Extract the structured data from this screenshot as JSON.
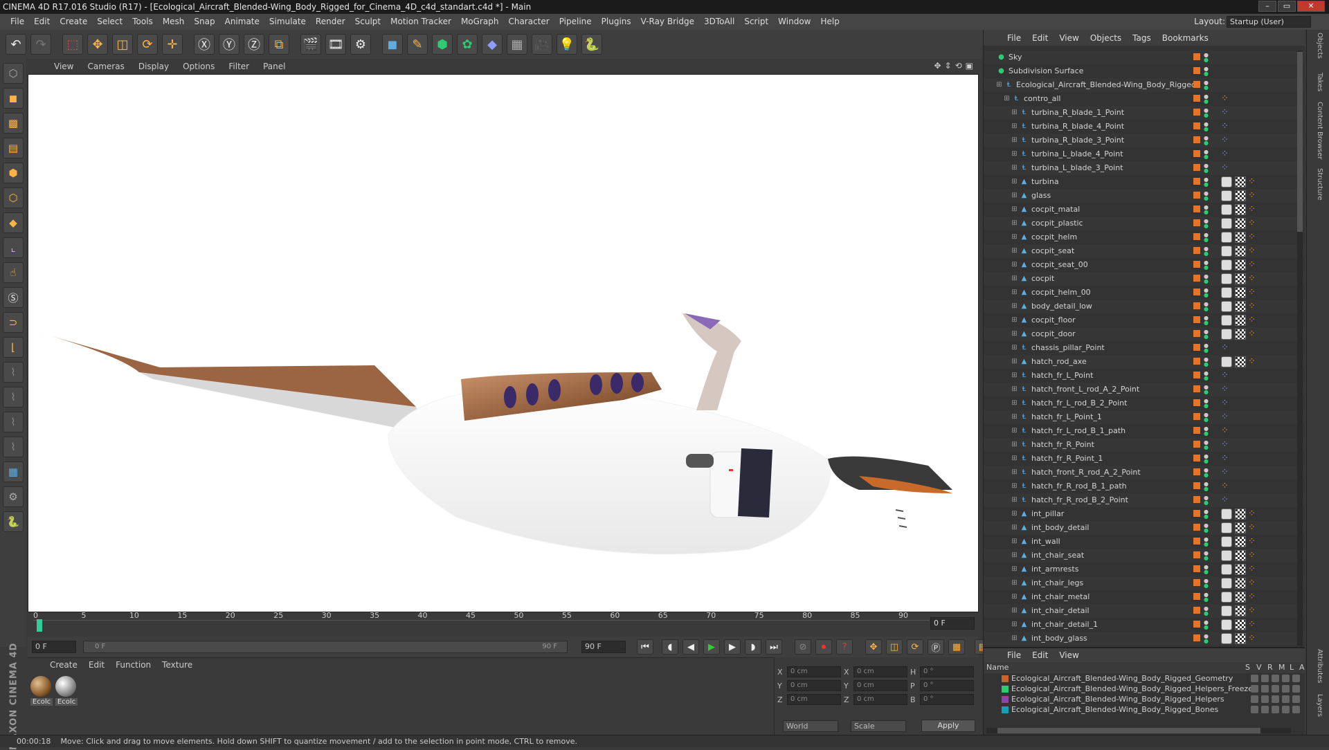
{
  "window": {
    "title": "CINEMA 4D R17.016 Studio (R17) - [Ecological_Aircraft_Blended-Wing_Body_Rigged_for_Cinema_4D_c4d_standart.c4d *] - Main",
    "buttons": [
      "–",
      "▭",
      "✕"
    ]
  },
  "menu": [
    "File",
    "Edit",
    "Create",
    "Select",
    "Tools",
    "Mesh",
    "Snap",
    "Animate",
    "Simulate",
    "Render",
    "Sculpt",
    "Motion Tracker",
    "MoGraph",
    "Character",
    "Pipeline",
    "Plugins",
    "V-Ray Bridge",
    "3DToAll",
    "Script",
    "Window",
    "Help"
  ],
  "layout": {
    "label": "Layout:",
    "value": "Startup (User)"
  },
  "viewport": {
    "menu": [
      "View",
      "Cameras",
      "Display",
      "Options",
      "Filter",
      "Panel"
    ]
  },
  "timeline": {
    "ticks": [
      "0",
      "5",
      "10",
      "15",
      "20",
      "25",
      "30",
      "35",
      "40",
      "45",
      "50",
      "55",
      "60",
      "65",
      "70",
      "75",
      "80",
      "85",
      "90"
    ],
    "end_field": "0 F"
  },
  "transport": {
    "start": "0 F",
    "slider_left": "0 F",
    "slider_right": "90 F",
    "end": "90 F"
  },
  "materials": {
    "menu": [
      "Create",
      "Edit",
      "Function",
      "Texture"
    ],
    "items": [
      "Ecolc",
      "Ecolc"
    ]
  },
  "coords": {
    "rows": [
      {
        "a": "X",
        "av": "0 cm",
        "b": "X",
        "bv": "0 cm",
        "c": "H",
        "cv": "0 °"
      },
      {
        "a": "Y",
        "av": "0 cm",
        "b": "Y",
        "bv": "0 cm",
        "c": "P",
        "cv": "0 °"
      },
      {
        "a": "Z",
        "av": "0 cm",
        "b": "Z",
        "bv": "0 cm",
        "c": "B",
        "cv": "0 °"
      }
    ],
    "mode": "World",
    "scale": "Scale",
    "apply": "Apply"
  },
  "objects": {
    "menu": [
      "File",
      "Edit",
      "View",
      "Objects",
      "Tags",
      "Bookmarks"
    ],
    "items": [
      {
        "name": "Sky",
        "indent": 0,
        "tags": 0
      },
      {
        "name": "Subdivision Surface",
        "indent": 0,
        "tags": 0
      },
      {
        "name": "Ecological_Aircraft_Blended-Wing_Body_Rigged",
        "indent": 1,
        "tags": 0
      },
      {
        "name": "contro_all",
        "indent": 2,
        "tags": 1
      },
      {
        "name": "turbina_R_blade_1_Point",
        "indent": 3,
        "tags": 0
      },
      {
        "name": "turbina_R_blade_4_Point",
        "indent": 3,
        "tags": 0
      },
      {
        "name": "turbina_R_blade_3_Point",
        "indent": 3,
        "tags": 0
      },
      {
        "name": "turbina_L_blade_4_Point",
        "indent": 3,
        "tags": 0
      },
      {
        "name": "turbina_L_blade_3_Point",
        "indent": 3,
        "tags": 0
      },
      {
        "name": "turbina",
        "indent": 3,
        "tags": 3
      },
      {
        "name": "glass",
        "indent": 3,
        "tags": 3
      },
      {
        "name": "cocpit_matal",
        "indent": 3,
        "tags": 3
      },
      {
        "name": "cocpit_plastic",
        "indent": 3,
        "tags": 3
      },
      {
        "name": "cocpit_helm",
        "indent": 3,
        "tags": 3
      },
      {
        "name": "cocpit_seat",
        "indent": 3,
        "tags": 3
      },
      {
        "name": "cocpit_seat_00",
        "indent": 3,
        "tags": 3
      },
      {
        "name": "cocpit",
        "indent": 3,
        "tags": 3
      },
      {
        "name": "cocpit_helm_00",
        "indent": 3,
        "tags": 3
      },
      {
        "name": "body_detail_low",
        "indent": 3,
        "tags": 3
      },
      {
        "name": "cocpit_floor",
        "indent": 3,
        "tags": 3
      },
      {
        "name": "cocpit_door",
        "indent": 3,
        "tags": 3
      },
      {
        "name": "chassis_pillar_Point",
        "indent": 3,
        "tags": 0
      },
      {
        "name": "hatch_rod_axe",
        "indent": 3,
        "tags": 3
      },
      {
        "name": "hatch_fr_L_Point",
        "indent": 3,
        "tags": 0
      },
      {
        "name": "hatch_front_L_rod_A_2_Point",
        "indent": 3,
        "tags": 0
      },
      {
        "name": "hatch_fr_L_rod_B_2_Point",
        "indent": 3,
        "tags": 0
      },
      {
        "name": "hatch_fr_L_Point_1",
        "indent": 3,
        "tags": 0
      },
      {
        "name": "hatch_fr_L_rod_B_1_path",
        "indent": 3,
        "tags": 1
      },
      {
        "name": "hatch_fr_R_Point",
        "indent": 3,
        "tags": 0
      },
      {
        "name": "hatch_fr_R_Point_1",
        "indent": 3,
        "tags": 0
      },
      {
        "name": "hatch_front_R_rod_A_2_Point",
        "indent": 3,
        "tags": 0
      },
      {
        "name": "hatch_fr_R_rod_B_1_path",
        "indent": 3,
        "tags": 1
      },
      {
        "name": "hatch_fr_R_rod_B_2_Point",
        "indent": 3,
        "tags": 0
      },
      {
        "name": "int_pillar",
        "indent": 3,
        "tags": 3
      },
      {
        "name": "int_body_detail",
        "indent": 3,
        "tags": 3
      },
      {
        "name": "int_wall",
        "indent": 3,
        "tags": 3
      },
      {
        "name": "int_chair_seat",
        "indent": 3,
        "tags": 3
      },
      {
        "name": "int_armrests",
        "indent": 3,
        "tags": 3
      },
      {
        "name": "int_chair_legs",
        "indent": 3,
        "tags": 3
      },
      {
        "name": "int_chair_metal",
        "indent": 3,
        "tags": 3
      },
      {
        "name": "int_chair_detail",
        "indent": 3,
        "tags": 3
      },
      {
        "name": "int_chair_detail_1",
        "indent": 3,
        "tags": 3
      },
      {
        "name": "int_body_glass",
        "indent": 3,
        "tags": 3
      }
    ]
  },
  "layers": {
    "menu": [
      "File",
      "Edit",
      "View"
    ],
    "header": {
      "name": "Name",
      "cols": [
        "S",
        "V",
        "R",
        "M",
        "L",
        "A"
      ]
    },
    "items": [
      {
        "name": "Ecological_Aircraft_Blended-Wing_Body_Rigged_Geometry",
        "color": "#c8642a"
      },
      {
        "name": "Ecological_Aircraft_Blended-Wing_Body_Rigged_Helpers_Freeze",
        "color": "#2ecc71"
      },
      {
        "name": "Ecological_Aircraft_Blended-Wing_Body_Rigged_Helpers",
        "color": "#8e44ad"
      },
      {
        "name": "Ecological_Aircraft_Blended-Wing_Body_Rigged_Bones",
        "color": "#16a0b8"
      }
    ]
  },
  "right_tabs": [
    "Objects",
    "Takes",
    "Content Browser",
    "Structure"
  ],
  "right_tabs_bottom": [
    "Attributes",
    "Layers"
  ],
  "status": {
    "time": "00:00:18",
    "message": "Move: Click and drag to move elements. Hold down SHIFT to quantize movement / add to the selection in point mode, CTRL to remove."
  },
  "brand": "MAXON CINEMA 4D"
}
